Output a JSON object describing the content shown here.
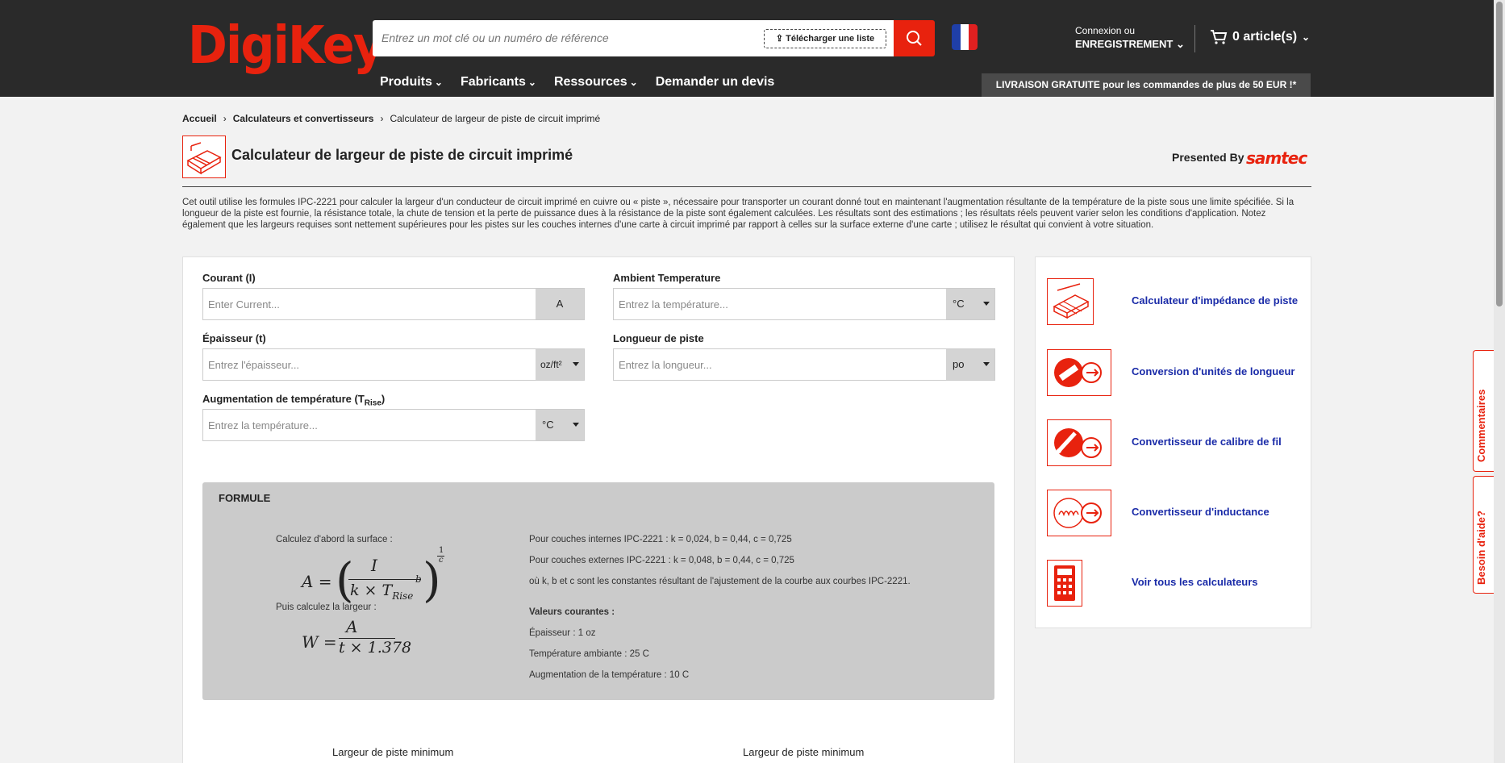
{
  "header": {
    "logo": "DigiKey",
    "search_placeholder": "Entrez un mot clé ou un numéro de référence",
    "upload_label": "Télécharger une liste",
    "login_line1": "Connexion ou",
    "login_line2": "ENREGISTREMENT",
    "cart_label": "0 article(s)",
    "nav": [
      "Produits",
      "Fabricants",
      "Ressources",
      "Demander un devis"
    ],
    "shipping_banner": "LIVRAISON GRATUITE pour les commandes de plus de 50 EUR !*"
  },
  "breadcrumb": {
    "home": "Accueil",
    "section": "Calculateurs et convertisseurs",
    "current": "Calculateur de largeur de piste de circuit imprimé"
  },
  "page": {
    "title": "Calculateur de largeur de piste de circuit imprimé",
    "presented_by": "Presented By",
    "sponsor": "samtec",
    "description": "Cet outil utilise les formules IPC-2221 pour calculer la largeur d'un conducteur de circuit imprimé en cuivre ou « piste », nécessaire pour transporter un courant donné tout en maintenant l'augmentation résultante de la température de la piste sous une limite spécifiée. Si la longueur de la piste est fournie, la résistance totale, la chute de tension et la perte de puissance dues à la résistance de la piste sont également calculées. Les résultats sont des estimations ; les résultats réels peuvent varier selon les conditions d'application. Notez également que les largeurs requises sont nettement supérieures pour les pistes sur les couches internes d'une carte à circuit imprimé par rapport à celles sur la surface externe d'une carte ; utilisez le résultat qui convient à votre situation."
  },
  "form": {
    "current": {
      "label": "Courant (I)",
      "placeholder": "Enter Current...",
      "unit": "A"
    },
    "ambient": {
      "label": "Ambient Temperature",
      "placeholder": "Entrez la température...",
      "unit": "°C"
    },
    "thickness": {
      "label": "Épaisseur (t)",
      "placeholder": "Entrez l'épaisseur...",
      "unit": "oz/ft²"
    },
    "length": {
      "label": "Longueur de piste",
      "placeholder": "Entrez la longueur...",
      "unit": "po"
    },
    "rise": {
      "label": "Augmentation de température (T",
      "label_sub": "Rise",
      "label_end": ")",
      "placeholder": "Entrez la température...",
      "unit": "°C"
    }
  },
  "formula": {
    "title": "FORMULE",
    "step1": "Calculez d'abord la surface :",
    "step2": "Puis calculez la largeur :",
    "internal": "Pour couches internes IPC-2221 : k = 0,024, b = 0,44, c = 0,725",
    "external": "Pour couches externes IPC-2221 : k = 0,048, b = 0,44, c = 0,725",
    "constants": "où k, b et c sont les constantes résultant de l'ajustement de la courbe aux courbes IPC-2221.",
    "typical_title": "Valeurs courantes :",
    "typical": [
      "Épaisseur : 1 oz",
      "Température ambiante : 25 C",
      "Augmentation de la température : 10 C"
    ],
    "eq": {
      "a_lhs": "A =",
      "a_num": "I",
      "a_den": "k × T",
      "a_den_sub": "Rise",
      "a_den_sup": "b",
      "a_exp_num": "1",
      "a_exp_den": "c",
      "w_lhs": "W =",
      "w_num": "A",
      "w_den": "t × 1.378"
    }
  },
  "results": {
    "left": "Largeur de piste minimum",
    "right": "Largeur de piste minimum"
  },
  "sidebar": {
    "items": [
      {
        "label": "Calculateur d'impédance de piste",
        "icon": "trace-impedance-icon"
      },
      {
        "label": "Conversion d'unités de longueur",
        "icon": "length-conversion-icon"
      },
      {
        "label": "Convertisseur de calibre de fil",
        "icon": "wire-gauge-icon"
      },
      {
        "label": "Convertisseur d'inductance",
        "icon": "inductance-icon"
      },
      {
        "label": "Voir tous les calculateurs",
        "icon": "calculator-icon"
      }
    ]
  },
  "tabs": {
    "feedback": "Commentaires",
    "help": "Besoin d'aide?"
  },
  "colors": {
    "brand": "#e8220e",
    "link": "#1a2ba8",
    "header": "#2a2a2a"
  }
}
